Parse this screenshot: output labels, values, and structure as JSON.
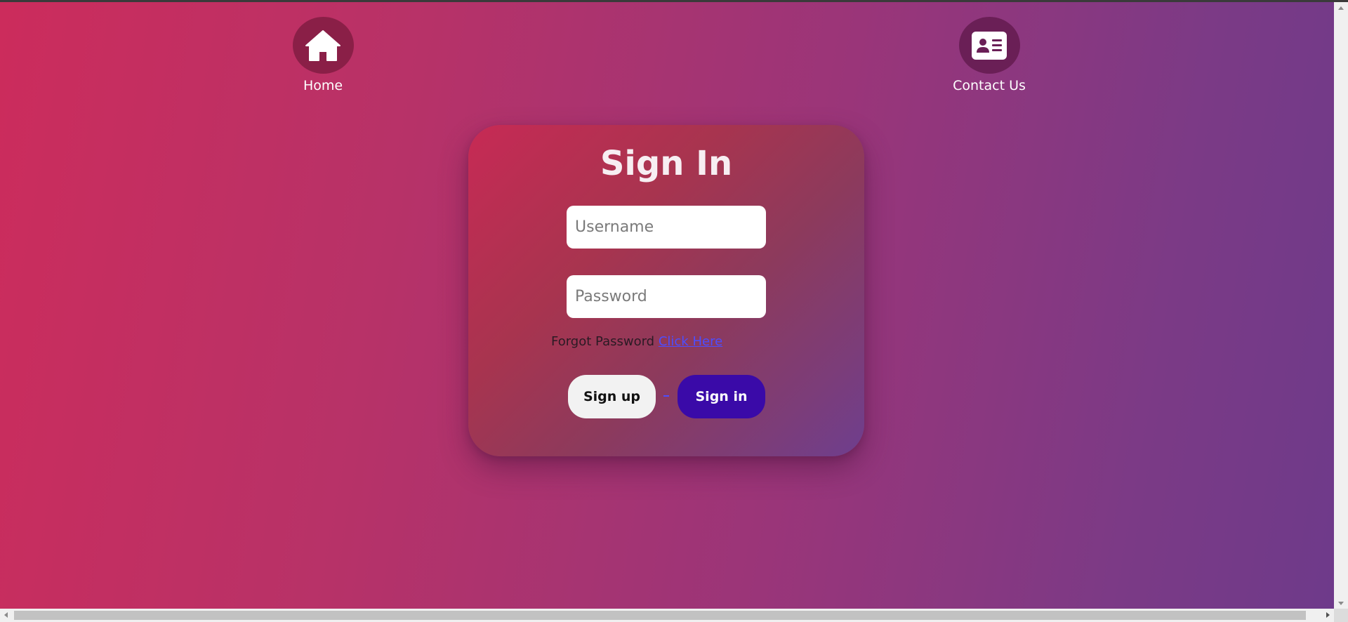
{
  "nav": {
    "home_label": "Home",
    "contact_label": "Contact Us",
    "home_icon": "house-icon",
    "contact_icon": "contact-card-icon"
  },
  "signin_card": {
    "title": "Sign In",
    "username_placeholder": "Username",
    "username_value": "",
    "password_placeholder": "Password",
    "password_value": "",
    "forgot_text": "Forgot Password",
    "forgot_link": "Click Here",
    "signup_label": "Sign up",
    "signin_label": "Sign in"
  },
  "colors": {
    "background_start": "#cc2c5c",
    "background_end": "#6e3a8a",
    "signin_button": "#3a0aa8",
    "signup_button": "#f2f2f2",
    "link": "#4d4dff"
  }
}
